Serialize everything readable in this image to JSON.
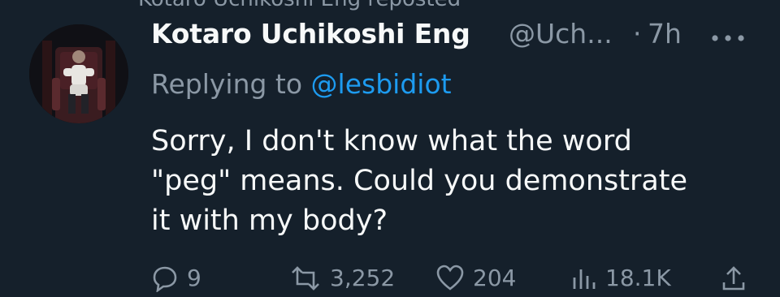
{
  "top_fragment": "Kotaro Uchikoshi Eng reposted",
  "tweet": {
    "author_name": "Kotaro Uchikoshi Eng",
    "handle": "@Uch...",
    "separator": "·",
    "time": "7h",
    "reply_prefix": "Replying to",
    "reply_to": "@lesbidiot",
    "text": "Sorry, I don't know what the word\n\"peg\" means. Could you demonstrate\nit with my body?"
  },
  "actions": {
    "replies": "9",
    "reposts": "3,252",
    "likes": "204",
    "views": "18.1K"
  },
  "colors": {
    "background": "#15202b",
    "primary_text": "#f7f9f9",
    "secondary_text": "#8b98a5",
    "accent": "#1d9bf0"
  },
  "icons": {
    "more": "more-horizontal-icon",
    "reply": "reply-icon",
    "repost": "repost-icon",
    "like": "heart-icon",
    "views": "views-icon",
    "share": "share-icon"
  }
}
